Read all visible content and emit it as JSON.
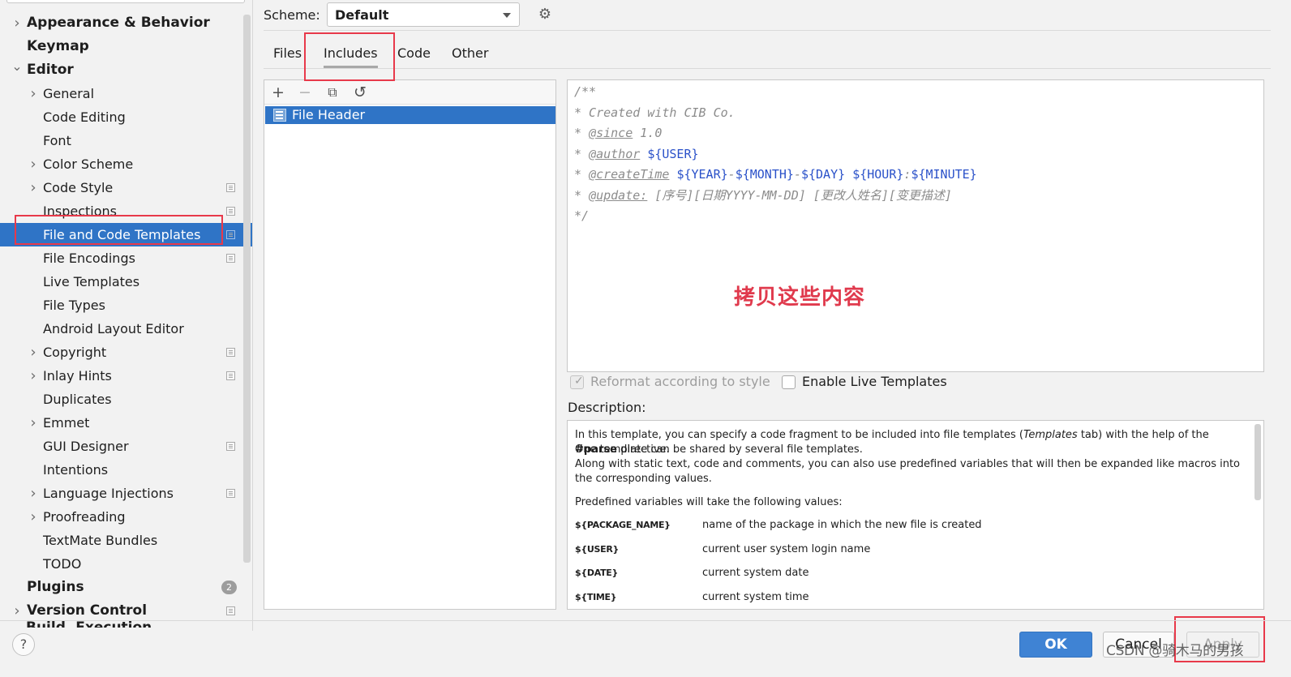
{
  "sidebar": {
    "items": [
      {
        "label": "Appearance & Behavior",
        "level": 0,
        "expandable": true,
        "expanded": false
      },
      {
        "label": "Keymap",
        "level": 0,
        "expandable": false
      },
      {
        "label": "Editor",
        "level": 0,
        "expandable": true,
        "expanded": true
      },
      {
        "label": "General",
        "level": 1,
        "expandable": true,
        "expanded": false
      },
      {
        "label": "Code Editing",
        "level": 1
      },
      {
        "label": "Font",
        "level": 1
      },
      {
        "label": "Color Scheme",
        "level": 1,
        "expandable": true,
        "expanded": false
      },
      {
        "label": "Code Style",
        "level": 1,
        "expandable": true,
        "expanded": false,
        "project_icon": true
      },
      {
        "label": "Inspections",
        "level": 1,
        "project_icon": true
      },
      {
        "label": "File and Code Templates",
        "level": 1,
        "project_icon": true,
        "selected": true
      },
      {
        "label": "File Encodings",
        "level": 1,
        "project_icon": true
      },
      {
        "label": "Live Templates",
        "level": 1
      },
      {
        "label": "File Types",
        "level": 1
      },
      {
        "label": "Android Layout Editor",
        "level": 1
      },
      {
        "label": "Copyright",
        "level": 1,
        "expandable": true,
        "expanded": false,
        "project_icon": true
      },
      {
        "label": "Inlay Hints",
        "level": 1,
        "expandable": true,
        "expanded": false,
        "project_icon": true
      },
      {
        "label": "Duplicates",
        "level": 1
      },
      {
        "label": "Emmet",
        "level": 1,
        "expandable": true,
        "expanded": false
      },
      {
        "label": "GUI Designer",
        "level": 1,
        "project_icon": true
      },
      {
        "label": "Intentions",
        "level": 1
      },
      {
        "label": "Language Injections",
        "level": 1,
        "expandable": true,
        "expanded": false,
        "project_icon": true
      },
      {
        "label": "Proofreading",
        "level": 1,
        "expandable": true,
        "expanded": false
      },
      {
        "label": "TextMate Bundles",
        "level": 1
      },
      {
        "label": "TODO",
        "level": 1
      },
      {
        "label": "Plugins",
        "level": 0,
        "badge": "2"
      },
      {
        "label": "Version Control",
        "level": 0,
        "expandable": true,
        "expanded": false,
        "project_icon": true
      }
    ],
    "cut_off_item": "Build, Execution, Deployment"
  },
  "scheme": {
    "label": "Scheme:",
    "value": "Default",
    "gear_icon": "gear-icon"
  },
  "tabs": [
    {
      "label": "Files",
      "active": false
    },
    {
      "label": "Includes",
      "active": true
    },
    {
      "label": "Code",
      "active": false
    },
    {
      "label": "Other",
      "active": false
    }
  ],
  "template_list": {
    "toolbar": {
      "add": "+",
      "remove": "−",
      "copy": "⧉",
      "reset": "↺"
    },
    "items": [
      {
        "label": "File Header",
        "selected": true,
        "icon": "file-template-icon"
      }
    ]
  },
  "editor": {
    "lines": [
      [
        {
          "t": "/**",
          "k": "c"
        }
      ],
      [
        {
          "t": "* Created with CIB Co.",
          "k": "c"
        }
      ],
      [
        {
          "t": "* ",
          "k": "c"
        },
        {
          "t": "@since",
          "k": "tag"
        },
        {
          "t": " 1.0",
          "k": "c"
        }
      ],
      [
        {
          "t": "* ",
          "k": "c"
        },
        {
          "t": "@author",
          "k": "tag"
        },
        {
          "t": " ",
          "k": "c"
        },
        {
          "t": "${USER}",
          "k": "var"
        }
      ],
      [
        {
          "t": "* ",
          "k": "c"
        },
        {
          "t": "@createTime",
          "k": "tag"
        },
        {
          "t": " ",
          "k": "c"
        },
        {
          "t": "${YEAR}",
          "k": "var"
        },
        {
          "t": "-",
          "k": "c"
        },
        {
          "t": "${MONTH}",
          "k": "var"
        },
        {
          "t": "-",
          "k": "c"
        },
        {
          "t": "${DAY}",
          "k": "var"
        },
        {
          "t": " ",
          "k": "c"
        },
        {
          "t": "${HOUR}",
          "k": "var"
        },
        {
          "t": ":",
          "k": "c"
        },
        {
          "t": "${MINUTE}",
          "k": "var"
        }
      ],
      [
        {
          "t": "* ",
          "k": "c"
        },
        {
          "t": "@update:",
          "k": "tag"
        },
        {
          "t": " [序号][日期YYYY-MM-DD] [更改人姓名][变更描述]",
          "k": "c"
        }
      ],
      [
        {
          "t": "*/",
          "k": "c"
        }
      ]
    ],
    "annotation": "拷贝这些内容"
  },
  "options": {
    "reformat": {
      "label": "Reformat according to style",
      "checked": true,
      "disabled": true
    },
    "live_templates": {
      "label": "Enable Live Templates",
      "checked": false
    }
  },
  "description": {
    "label": "Description:",
    "p1_a": "In this template, you can specify a code fragment to be included into file templates (",
    "p1_em": "Templates",
    "p1_b": " tab) with the help of the ",
    "p1_strong": "#parse",
    "p1_c": " directive.",
    "p2": "One template can be shared by several file templates.",
    "p3": "Along with static text, code and comments, you can also use predefined variables that will then be expanded like macros into the corresponding values.",
    "p4": "Predefined variables will take the following values:",
    "variables": [
      {
        "name": "${PACKAGE_NAME}",
        "desc": "name of the package in which the new file is created"
      },
      {
        "name": "${USER}",
        "desc": "current user system login name"
      },
      {
        "name": "${DATE}",
        "desc": "current system date"
      },
      {
        "name": "${TIME}",
        "desc": "current system time"
      }
    ]
  },
  "buttons": {
    "help": "?",
    "ok": "OK",
    "cancel": "Cancel",
    "apply": "Apply"
  },
  "watermark": "CSDN @骑木马的男孩",
  "colors": {
    "selection": "#2f74c6",
    "highlight_box": "#e8394a",
    "annotation": "#e03a4d",
    "ok_button": "#3f83d4",
    "template_variable": "#2a51c9"
  }
}
